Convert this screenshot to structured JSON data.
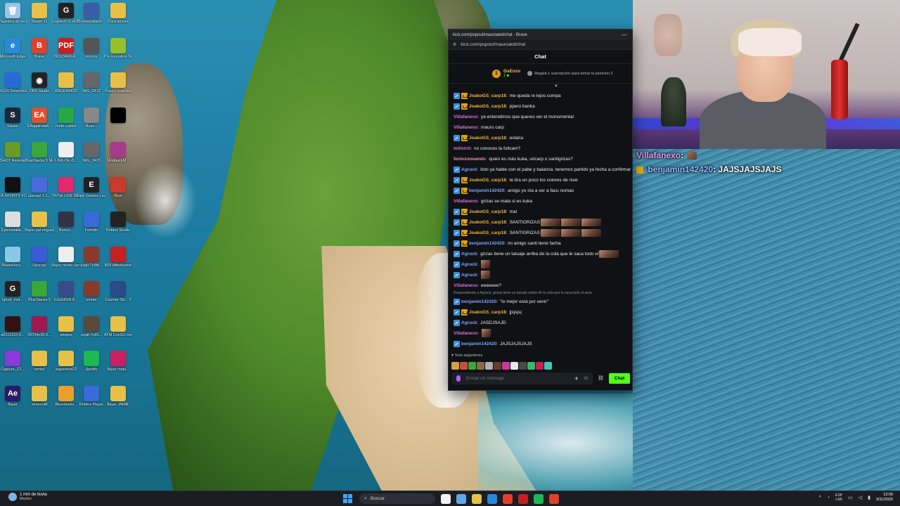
{
  "browser": {
    "window_title": "kick.com/popout/mauroakd/chat - Brave",
    "url": "kick.com/popout/mauroakd/chat",
    "minimize_symbol": "—"
  },
  "chat": {
    "header": "Chat",
    "pinned": {
      "rank": "1",
      "name": "GsEnzo",
      "subline": "1 ■",
      "promo": "Regala 1 suscripción para tomar la posición 2"
    },
    "messages": [
      {
        "user": "JoakoGS_carp18",
        "color": "c-orange",
        "badges": [
          "blue",
          "gold"
        ],
        "text": "me queda re lejos compa"
      },
      {
        "user": "JoakoGS_carp18",
        "color": "c-orange",
        "badges": [
          "blue",
          "gold"
        ],
        "text": "ppero banka"
      },
      {
        "user": "Villafanexo",
        "color": "c-purple",
        "badges": [],
        "text": "ya entendimos que queres ver el monumental"
      },
      {
        "user": "Villafanexo",
        "color": "c-purple",
        "badges": [],
        "text": "mauro carp"
      },
      {
        "user": "JoakoGS_carp18",
        "color": "c-orange",
        "badges": [
          "blue",
          "gold"
        ],
        "text": "estaria"
      },
      {
        "user": "milivich",
        "color": "c-purple",
        "badges": [],
        "text": "no conoces la fullcam?"
      },
      {
        "user": "fenixzoneando",
        "color": "c-pink",
        "badges": [],
        "text": "quien es más kuka, uricarp o santigrizas?"
      },
      {
        "user": "Agruck",
        "color": "c-blue",
        "badges": [
          "blue"
        ],
        "text": "listo ya hable con el pabe y balanza. tenemos partido ya fecha a confirmar"
      },
      {
        "user": "JoakoGS_carp18",
        "color": "c-orange",
        "badges": [
          "blue",
          "gold"
        ],
        "text": "te tira un poco los colores de river"
      },
      {
        "user": "benjamin142420",
        "color": "c-blue",
        "badges": [
          "blue",
          "gold"
        ],
        "text": "amigo yo iria a ver a facu nomas"
      },
      {
        "user": "Villafanexo",
        "color": "c-purple",
        "badges": [],
        "text": "grizas se mata si es kuka"
      },
      {
        "user": "JoakoGS_carp18",
        "color": "c-orange",
        "badges": [
          "blue",
          "gold"
        ],
        "text": "mal"
      },
      {
        "user": "JoakoGS_carp18",
        "color": "c-orange",
        "badges": [
          "blue",
          "gold"
        ],
        "text": "SANTIGRIZAS",
        "emotes": 3
      },
      {
        "user": "JoakoGS_carp18",
        "color": "c-orange",
        "badges": [
          "blue",
          "gold"
        ],
        "text": "SANTIGRIZAS",
        "emotes": 3
      },
      {
        "user": "benjamin142420",
        "color": "c-blue",
        "badges": [
          "blue",
          "gold"
        ],
        "text": "mi amigo santi tiene facha"
      },
      {
        "user": "Agruck",
        "color": "c-blue",
        "badges": [
          "blue"
        ],
        "text": "grizas tiene un tatuaje arriba de la cola que le saca todo el",
        "emotes": 1
      },
      {
        "user": "Agruck",
        "color": "c-blue",
        "badges": [
          "blue"
        ],
        "text": "",
        "emotes_sq": 1
      },
      {
        "user": "Agruck",
        "color": "c-blue",
        "badges": [
          "blue"
        ],
        "text": "",
        "emotes_sq": 1
      },
      {
        "user": "Villafanexo",
        "color": "c-purple",
        "badges": [],
        "text": "eeeeeee?"
      },
      {
        "user": "benjamin142420",
        "color": "c-blue",
        "badges": [
          "blue"
        ],
        "text": "\"lo mejor está por venir\""
      },
      {
        "user": "JoakoGS_carp18",
        "color": "c-orange",
        "badges": [
          "blue",
          "gold"
        ],
        "text": "jjsjsjs("
      },
      {
        "user": "Agruck",
        "color": "c-blue",
        "badges": [
          "blue"
        ],
        "text": "JASDJSAJD"
      },
      {
        "user": "Villafanexo",
        "color": "c-purple",
        "badges": [],
        "text": "",
        "emotes_sq": 1
      },
      {
        "user": "benjamin142420",
        "color": "c-blue",
        "badges": [
          "blue"
        ],
        "text": "JAJSJAJSJAJS"
      }
    ],
    "reply_note": "Respondiendo a Agruck: grizas tiene un tatuaje arriba de la cola que le saca todo el aura",
    "followers_only": "Solo seguidores",
    "composer_placeholder": "Enviar un mensaje",
    "send_label": "Chat"
  },
  "overlay": {
    "line1_user": "Villafanexo",
    "line2_user": "benjamin142420",
    "line2_text": "JAJSJAJSJAJS"
  },
  "desktop_icons": [
    {
      "label": "Papelera de reciclaje",
      "color": "#9bc4e8",
      "g": "🗑"
    },
    {
      "label": "Steam 11",
      "color": "#e8c048",
      "g": ""
    },
    {
      "label": "Logitech G HUB",
      "color": "#222",
      "g": "G"
    },
    {
      "label": "universitario",
      "color": "#3a5da8",
      "g": ""
    },
    {
      "label": "Para lectura",
      "color": "#e8c048",
      "g": ""
    },
    {
      "label": "Microsoft Edge",
      "color": "#2a8ad8",
      "g": "e"
    },
    {
      "label": "Brave",
      "color": "#e0402a",
      "g": "B"
    },
    {
      "label": "DESCARGA...",
      "color": "#c82020",
      "g": "PDF"
    },
    {
      "label": "micros",
      "color": "#555",
      "g": ""
    },
    {
      "label": "Pro Evolution Soccer",
      "color": "#98c028",
      "g": ""
    },
    {
      "label": "ASUS DriverHub",
      "color": "#2a6ad8",
      "g": ""
    },
    {
      "label": "OBS Studio",
      "color": "#222",
      "g": "◉"
    },
    {
      "label": "ARGENMOD",
      "color": "#e8c048",
      "g": ""
    },
    {
      "label": "IMG_2412",
      "color": "#666",
      "g": ""
    },
    {
      "label": "Paso Localidad",
      "color": "#e8c048",
      "g": ""
    },
    {
      "label": "Steam",
      "color": "#1b2838",
      "g": "S"
    },
    {
      "label": "EAappinstall...",
      "color": "#e0502a",
      "g": "EA"
    },
    {
      "label": "mofo cuttins",
      "color": "#28a848",
      "g": ""
    },
    {
      "label": "Russ...",
      "color": "#888",
      "g": ""
    },
    {
      "label": "",
      "color": "#000",
      "g": ""
    },
    {
      "label": "SHOT Remote",
      "color": "#6a9a28",
      "g": ""
    },
    {
      "label": "BlueStacks 5 Multi-Insta...",
      "color": "#3aa838",
      "g": ""
    },
    {
      "label": "LINK-DE-D...",
      "color": "#eee",
      "g": ""
    },
    {
      "label": "IMG_2420",
      "color": "#666",
      "g": ""
    },
    {
      "label": "ModpackM...",
      "color": "#a83a8a",
      "g": ""
    },
    {
      "label": "EA SPORTS FC 25",
      "color": "#111",
      "g": ""
    },
    {
      "label": "upscayl-2.1...",
      "color": "#4a6ad8",
      "g": ""
    },
    {
      "label": "TikTok LIVE Studio",
      "color": "#e02a6a",
      "g": ""
    },
    {
      "label": "Epic Games Launcher",
      "color": "#222",
      "g": "E"
    },
    {
      "label": "Rust",
      "color": "#c83a2a",
      "g": ""
    },
    {
      "label": "Epicinstalla...",
      "color": "#ddd",
      "g": ""
    },
    {
      "label": "flayer pal miguel",
      "color": "#e8c048",
      "g": ""
    },
    {
      "label": "Banco...",
      "color": "#334",
      "g": ""
    },
    {
      "label": "Fortnite",
      "color": "#3a6ad8",
      "g": ""
    },
    {
      "label": "Roblox Studio",
      "color": "#222",
      "g": ""
    },
    {
      "label": "MisterHors...",
      "color": "#8ac8e8",
      "g": ""
    },
    {
      "label": "Upscayl",
      "color": "#3a5ad8",
      "g": ""
    },
    {
      "label": "flayer modo carrera",
      "color": "#eee",
      "g": ""
    },
    {
      "label": "ezgif-7c8fd...",
      "color": "#8a3a2a",
      "g": ""
    },
    {
      "label": "MSI Afterburner",
      "color": "#c82020",
      "g": ""
    },
    {
      "label": "lghub_inst...",
      "color": "#222",
      "g": "G"
    },
    {
      "label": "BlueStacks 5",
      "color": "#3aa838",
      "g": ""
    },
    {
      "label": "bcb2d2e5-8...",
      "color": "#3a4a8a",
      "g": ""
    },
    {
      "label": "emote",
      "color": "#8a3a2a",
      "g": ""
    },
    {
      "label": "Counter-Str... 2",
      "color": "#2a4a8a",
      "g": ""
    },
    {
      "label": "a6111310-5...",
      "color": "#311",
      "g": ""
    },
    {
      "label": "39704c35-6...",
      "color": "#a01850",
      "g": ""
    },
    {
      "label": "plugins",
      "color": "#e8c048",
      "g": ""
    },
    {
      "label": "ezgif-7c85...",
      "color": "#5a4a3a",
      "g": ""
    },
    {
      "label": "ATM ConSO mouse",
      "color": "#e8c048",
      "g": ""
    },
    {
      "label": "Capture_Z2...",
      "color": "#8a3ad8",
      "g": ""
    },
    {
      "label": "remini",
      "color": "#e8c048",
      "g": ""
    },
    {
      "label": "argenmod22",
      "color": "#e8c048",
      "g": ""
    },
    {
      "label": "Spotify",
      "color": "#1db954",
      "g": ""
    },
    {
      "label": "flayer moio...",
      "color": "#c82060",
      "g": ""
    },
    {
      "label": "flayer",
      "color": "#2a1a6a",
      "g": "Ae"
    },
    {
      "label": "minecraft",
      "color": "#e8c048",
      "g": ""
    },
    {
      "label": "Bluestacks...",
      "color": "#e8a028",
      "g": ""
    },
    {
      "label": "Roblox Player",
      "color": "#3a6ad8",
      "g": ""
    },
    {
      "label": "flayer JAIME",
      "color": "#e8c048",
      "g": ""
    }
  ],
  "taskbar": {
    "weather_line1": "1 mm de lluvia",
    "weather_line2": "Martes",
    "search_label": "Buscar",
    "lang_top": "ESP",
    "lang_bottom": "LAA",
    "time": "13:05",
    "date": "3/11/2025",
    "apps": [
      "#f4f4f4",
      "#5fa8e8",
      "#e8c048",
      "#2a8ad8",
      "#e0402a",
      "#c82020",
      "#1db954",
      "#e0402a"
    ]
  }
}
